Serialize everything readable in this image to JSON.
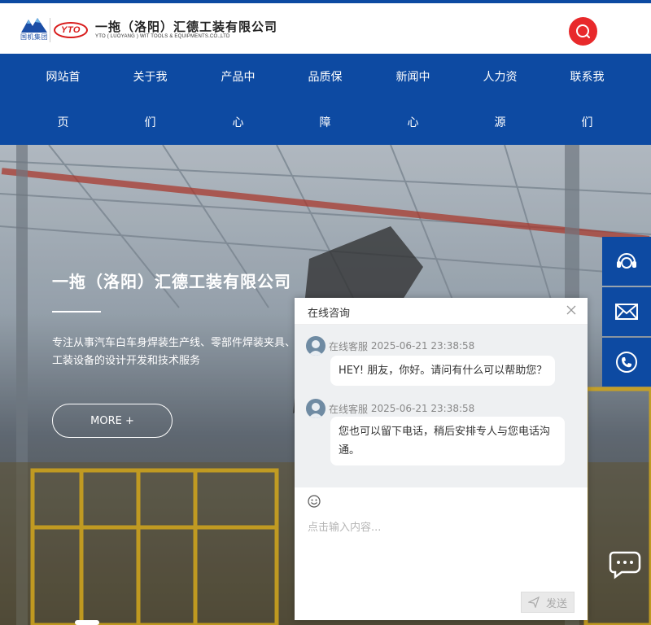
{
  "header": {
    "group_logo_caption": "国机集团",
    "yto_logo": "YTO",
    "company_cn": "一拖（洛阳）汇德工装有限公司",
    "company_en": "YTO ( LUOYANG ) WIT TOOLS & EQUIPMENTS.CO.,LTD",
    "search_icon": "search-icon"
  },
  "nav": {
    "items": [
      {
        "line1": "网站首",
        "line2": "页"
      },
      {
        "line1": "关于我",
        "line2": "们"
      },
      {
        "line1": "产品中",
        "line2": "心"
      },
      {
        "line1": "品质保",
        "line2": "障"
      },
      {
        "line1": "新闻中",
        "line2": "心"
      },
      {
        "line1": "人力资",
        "line2": "源"
      },
      {
        "line1": "联系我",
        "line2": "们"
      }
    ]
  },
  "hero": {
    "title": "一拖（洛阳）汇德工装有限公司",
    "description": "专注从事汽车白车身焊装生产线、零部件焊装夹具、工装设备的设计开发和技术服务",
    "more_label": "MORE +"
  },
  "side_tools": [
    "customer-service-icon",
    "mail-icon",
    "phone-icon"
  ],
  "chat": {
    "title": "在线咨询",
    "messages": [
      {
        "sender": "在线客服",
        "time": "2025-06-21 23:38:58",
        "text": "HEY! 朋友，你好。请问有什么可以帮助您？"
      },
      {
        "sender": "在线客服",
        "time": "2025-06-21 23:38:58",
        "text": "您也可以留下电话，稍后安排专人与您电话沟通。"
      }
    ],
    "input_placeholder": "点击输入内容...",
    "send_label": "发送"
  },
  "colors": {
    "brand_blue": "#0d4aa2",
    "accent_red": "#e8292b"
  }
}
